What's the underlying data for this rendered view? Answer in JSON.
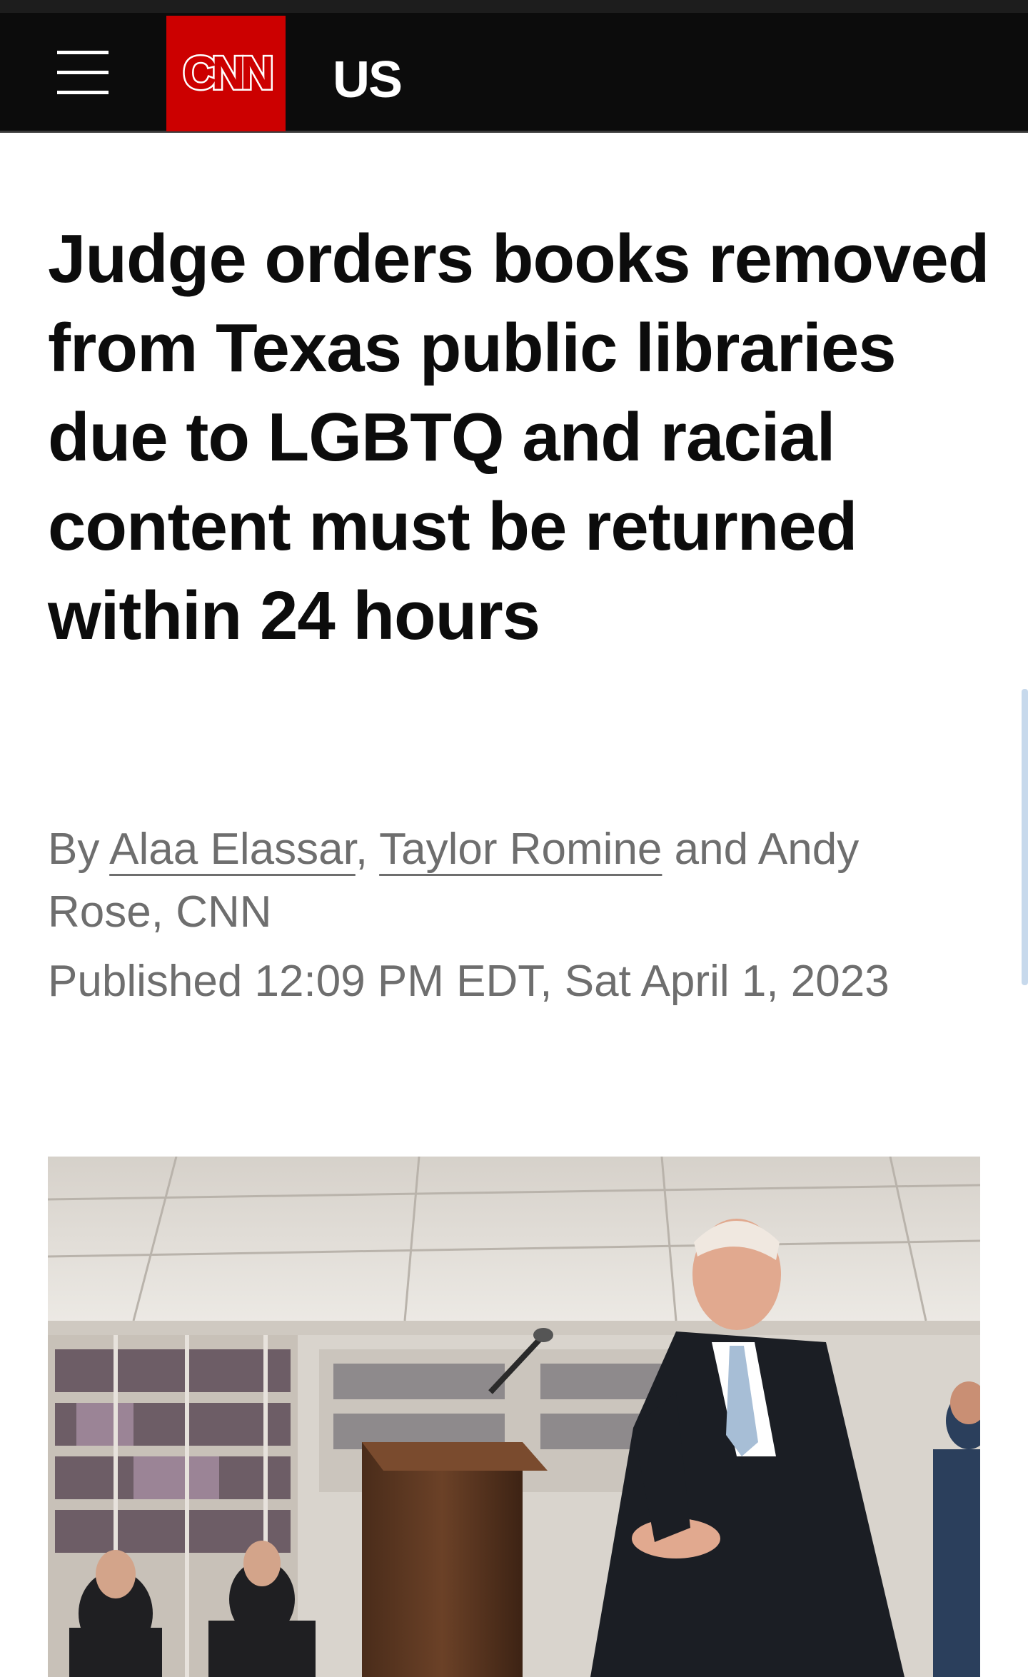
{
  "nav": {
    "menu_icon": "hamburger-menu-icon",
    "logo_text": "CNN",
    "section": "US"
  },
  "colors": {
    "brand_red": "#cc0000",
    "nav_background": "#0c0c0c",
    "headline": "#0c0c0c",
    "meta_text": "#6e6e6e"
  },
  "article": {
    "headline": "Judge orders books removed from Texas public libraries due to LGBTQ and racial content must be returned within 24 hours",
    "byline": {
      "prefix": "By",
      "author1": "Alaa Elassar",
      "sep1": ",",
      "author2": "Taylor Romine",
      "connector": "and Andy Rose, CNN"
    },
    "published": "Published 12:09 PM EDT, Sat April 1, 2023"
  }
}
